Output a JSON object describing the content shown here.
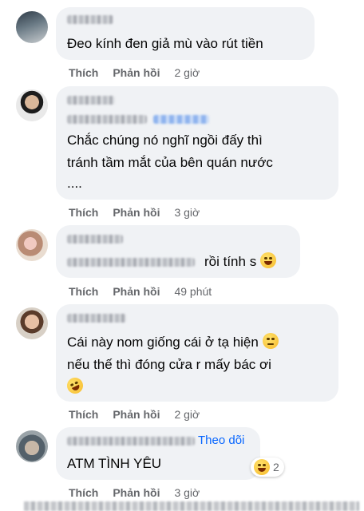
{
  "comments": [
    {
      "text_lines": [
        "Đeo kính đen giả mù vào rút tiền"
      ],
      "like": "Thích",
      "reply": "Phản hồi",
      "time": "2 giờ"
    },
    {
      "text_lines": [
        "Chắc chúng nó nghĩ ngồi đấy thì",
        "tránh tầm mắt của bên quán nước",
        "...."
      ],
      "like": "Thích",
      "reply": "Phản hồi",
      "time": "3 giờ"
    },
    {
      "text_lines": [
        "rồi tính s"
      ],
      "like": "Thích",
      "reply": "Phản hồi",
      "time": "49 phút",
      "emoji": "laugh-cry"
    },
    {
      "text_lines": [
        "Cái này nom giống cái ở tạ hiện",
        "nếu thế thì đóng cửa r mấy bác ơi"
      ],
      "like": "Thích",
      "reply": "Phản hồi",
      "time": "2 giờ",
      "emojis": [
        "eye-roll",
        "rofl"
      ]
    },
    {
      "text_lines": [
        "ATM TÌNH YÊU"
      ],
      "follow": "Theo dõi",
      "like": "Thích",
      "reply": "Phản hồi",
      "time": "3 giờ",
      "reaction_count": "2",
      "reaction_icon": "laughing-squint"
    }
  ],
  "colors": {
    "bubble": "#f0f2f5",
    "meta": "#65676b",
    "link": "#0866ff"
  }
}
